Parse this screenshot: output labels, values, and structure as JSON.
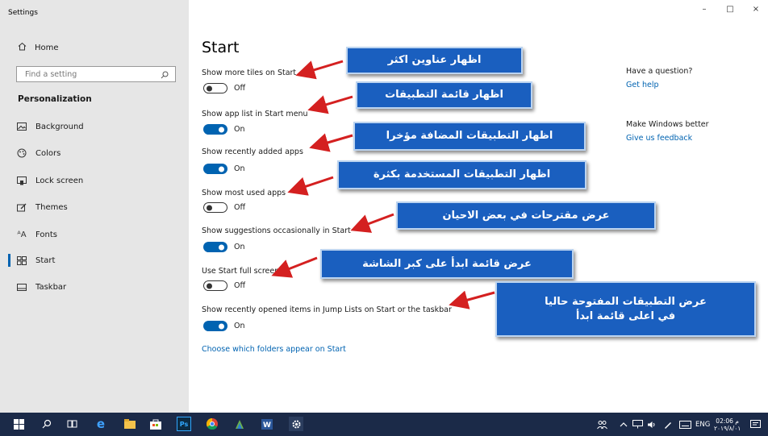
{
  "window": {
    "title": "Settings",
    "controls": [
      "–",
      "□",
      "×"
    ]
  },
  "sidebar": {
    "home": "Home",
    "search_placeholder": "Find a setting",
    "section": "Personalization",
    "items": [
      {
        "label": "Background",
        "icon": "image-icon"
      },
      {
        "label": "Colors",
        "icon": "palette-icon"
      },
      {
        "label": "Lock screen",
        "icon": "lock-screen-icon"
      },
      {
        "label": "Themes",
        "icon": "themes-icon"
      },
      {
        "label": "Fonts",
        "icon": "fonts-icon"
      },
      {
        "label": "Start",
        "icon": "start-icon",
        "active": true
      },
      {
        "label": "Taskbar",
        "icon": "taskbar-icon"
      }
    ]
  },
  "main": {
    "title": "Start",
    "settings": [
      {
        "label": "Show more tiles on Start",
        "state": "Off"
      },
      {
        "label": "Show app list in Start menu",
        "state": "On"
      },
      {
        "label": "Show recently added apps",
        "state": "On"
      },
      {
        "label": "Show most used apps",
        "state": "Off"
      },
      {
        "label": "Show suggestions occasionally in Start",
        "state": "On"
      },
      {
        "label": "Use Start full screen",
        "state": "Off"
      },
      {
        "label": "Show recently opened items in Jump Lists on Start or the taskbar",
        "state": "On"
      }
    ],
    "folders_link": "Choose which folders appear on Start",
    "question": {
      "heading": "Have a question?",
      "link": "Get help"
    },
    "feedback": {
      "heading": "Make Windows better",
      "link": "Give us feedback"
    }
  },
  "callouts": [
    "اظهار عناوين اكثر",
    "اظهار قائمة التطبيقات",
    "اظهار التطبيقات المضافة مؤخرا",
    "اظهار التطبيقات المستخدمة بكثرة",
    "عرض مقترحات في بعض الاحيان",
    "عرض قائمة ابدأ على كبر الشاشة",
    "عرض التطبيقات المفتوحة حاليا",
    "في اعلى قائمة ابدأ"
  ],
  "taskbar": {
    "lang": "ENG",
    "time": "02:06 م",
    "date": "٢٠١٩/٨/٠١"
  },
  "colors": {
    "accent": "#0063b1",
    "callout": "#1a5fbf",
    "arrow": "#d42020",
    "taskbar": "#1b2a48"
  }
}
